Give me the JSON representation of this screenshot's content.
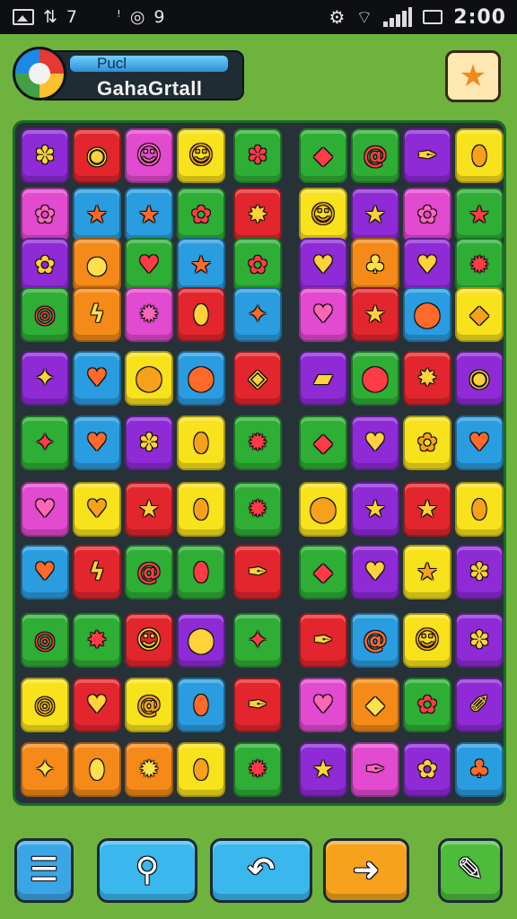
{
  "status_bar": {
    "left_icons": [
      "image-icon",
      "signal-arrows-icon",
      "location-icon",
      "app-icon"
    ],
    "left_texts": [
      "7",
      "9"
    ],
    "right_icons": [
      "settings-icon",
      "wifi-icon",
      "signal-icon",
      "battery-icon"
    ],
    "time": "2:00"
  },
  "header": {
    "title_small": "Pucl",
    "title": "GahaGrtall",
    "logo_icon": "game-logo-icon",
    "star_button_icon": "star-icon"
  },
  "colors": {
    "background": "#6fb33f",
    "board": "#263238",
    "tile_purple": "#8e2bd6",
    "tile_red": "#e3262e",
    "tile_pink": "#e24ad0",
    "tile_yellow": "#f7e21c",
    "tile_green": "#2fae36",
    "tile_blue": "#2a9de0",
    "tile_orange": "#f58a18"
  },
  "board": {
    "rows": 11,
    "columns": 9,
    "tiles": [
      [
        "purple:square-flower",
        "red:circle",
        "pink:face",
        "yellow:face",
        "green:square-flower",
        "green:leaf",
        "green:swirl",
        "purple:feather",
        "yellow:drop"
      ],
      [
        "pink:flower",
        "blue:star",
        "blue:star",
        "green:flower",
        "red:splat",
        "yellow:face",
        "purple:star",
        "pink:flower",
        "green:star"
      ],
      [
        "purple:flower",
        "orange:orb",
        "green:heart",
        "blue:star",
        "green:flower",
        "purple:heart",
        "orange:bulb",
        "purple:heart",
        "green:gear"
      ],
      [
        "green:ring",
        "orange:zap",
        "pink:gear",
        "red:drop",
        "blue:diamond",
        "pink:heart",
        "red:star",
        "blue:balloon",
        "yellow:leaf"
      ],
      [
        "purple:diamond",
        "blue:heart",
        "yellow:balloon",
        "blue:balloon",
        "red:kite",
        "purple:speech",
        "green:balloon",
        "red:splat",
        "purple:circle"
      ],
      [
        "green:diamond",
        "blue:heart",
        "purple:square-flower",
        "yellow:drop",
        "green:gear",
        "green:leaf",
        "purple:heart",
        "yellow:flower",
        "blue:heart"
      ],
      [
        "pink:heart",
        "yellow:heart",
        "red:star",
        "yellow:drop",
        "green:gear",
        "yellow:balloon",
        "purple:star",
        "red:star",
        "yellow:drop"
      ],
      [
        "blue:heart",
        "red:zap",
        "green:swirl",
        "green:drop",
        "red:feather",
        "green:leaf",
        "purple:heart",
        "yellow:star",
        "purple:square-flower"
      ],
      [
        "green:ring",
        "green:splat",
        "red:face",
        "purple:balloon",
        "green:diamond",
        "red:feather",
        "blue:swirl",
        "yellow:face",
        "purple:square-flower"
      ],
      [
        "yellow:ring",
        "red:heart",
        "yellow:swirl",
        "blue:drop",
        "red:feather",
        "pink:heart",
        "orange:leaf",
        "green:flower",
        "purple:pin"
      ],
      [
        "orange:diamond",
        "orange:drop",
        "orange:gear",
        "yellow:drop",
        "green:gear",
        "purple:star",
        "pink:feather",
        "purple:flower",
        "blue:bulb"
      ]
    ]
  },
  "bottom_bar": [
    {
      "name": "menu-button",
      "icon": "menu-icon",
      "glyph": "☰",
      "color": "#3aa6e6"
    },
    {
      "name": "search-button",
      "icon": "search-icon",
      "glyph": "⚲",
      "color": "#3ab8ee"
    },
    {
      "name": "undo-button",
      "icon": "undo-icon",
      "glyph": "↶",
      "color": "#3ab8ee"
    },
    {
      "name": "next-button",
      "icon": "arrow-right-icon",
      "glyph": "➜",
      "color": "#f6a21c"
    },
    {
      "name": "edit-button",
      "icon": "pencil-icon",
      "glyph": "✎",
      "color": "#4cbc3a"
    }
  ]
}
